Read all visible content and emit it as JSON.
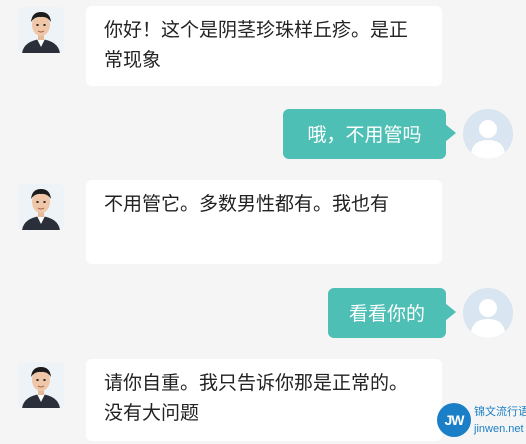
{
  "messages": [
    {
      "side": "in",
      "avatar": "doctor-avatar",
      "text": "你好！这个是阴茎珍珠样丘疹。是正常现象"
    },
    {
      "side": "out",
      "avatar": "user-avatar",
      "text": "哦，不用管吗"
    },
    {
      "side": "in",
      "avatar": "doctor-avatar",
      "text": "不用管它。多数男性都有。我也有"
    },
    {
      "side": "out",
      "avatar": "user-avatar",
      "text": "看看你的"
    },
    {
      "side": "in",
      "avatar": "doctor-avatar",
      "text": "请你自重。我只告诉你那是正常的。没有大问题"
    }
  ],
  "watermark": {
    "logo_text": "JW",
    "site_name": "锦文流行语",
    "url": "jinwen.net"
  },
  "colors": {
    "background": "#f5f5f5",
    "incoming_bubble": "#ffffff",
    "outgoing_bubble": "#4ebfb5",
    "watermark": "#1a7fc6"
  }
}
